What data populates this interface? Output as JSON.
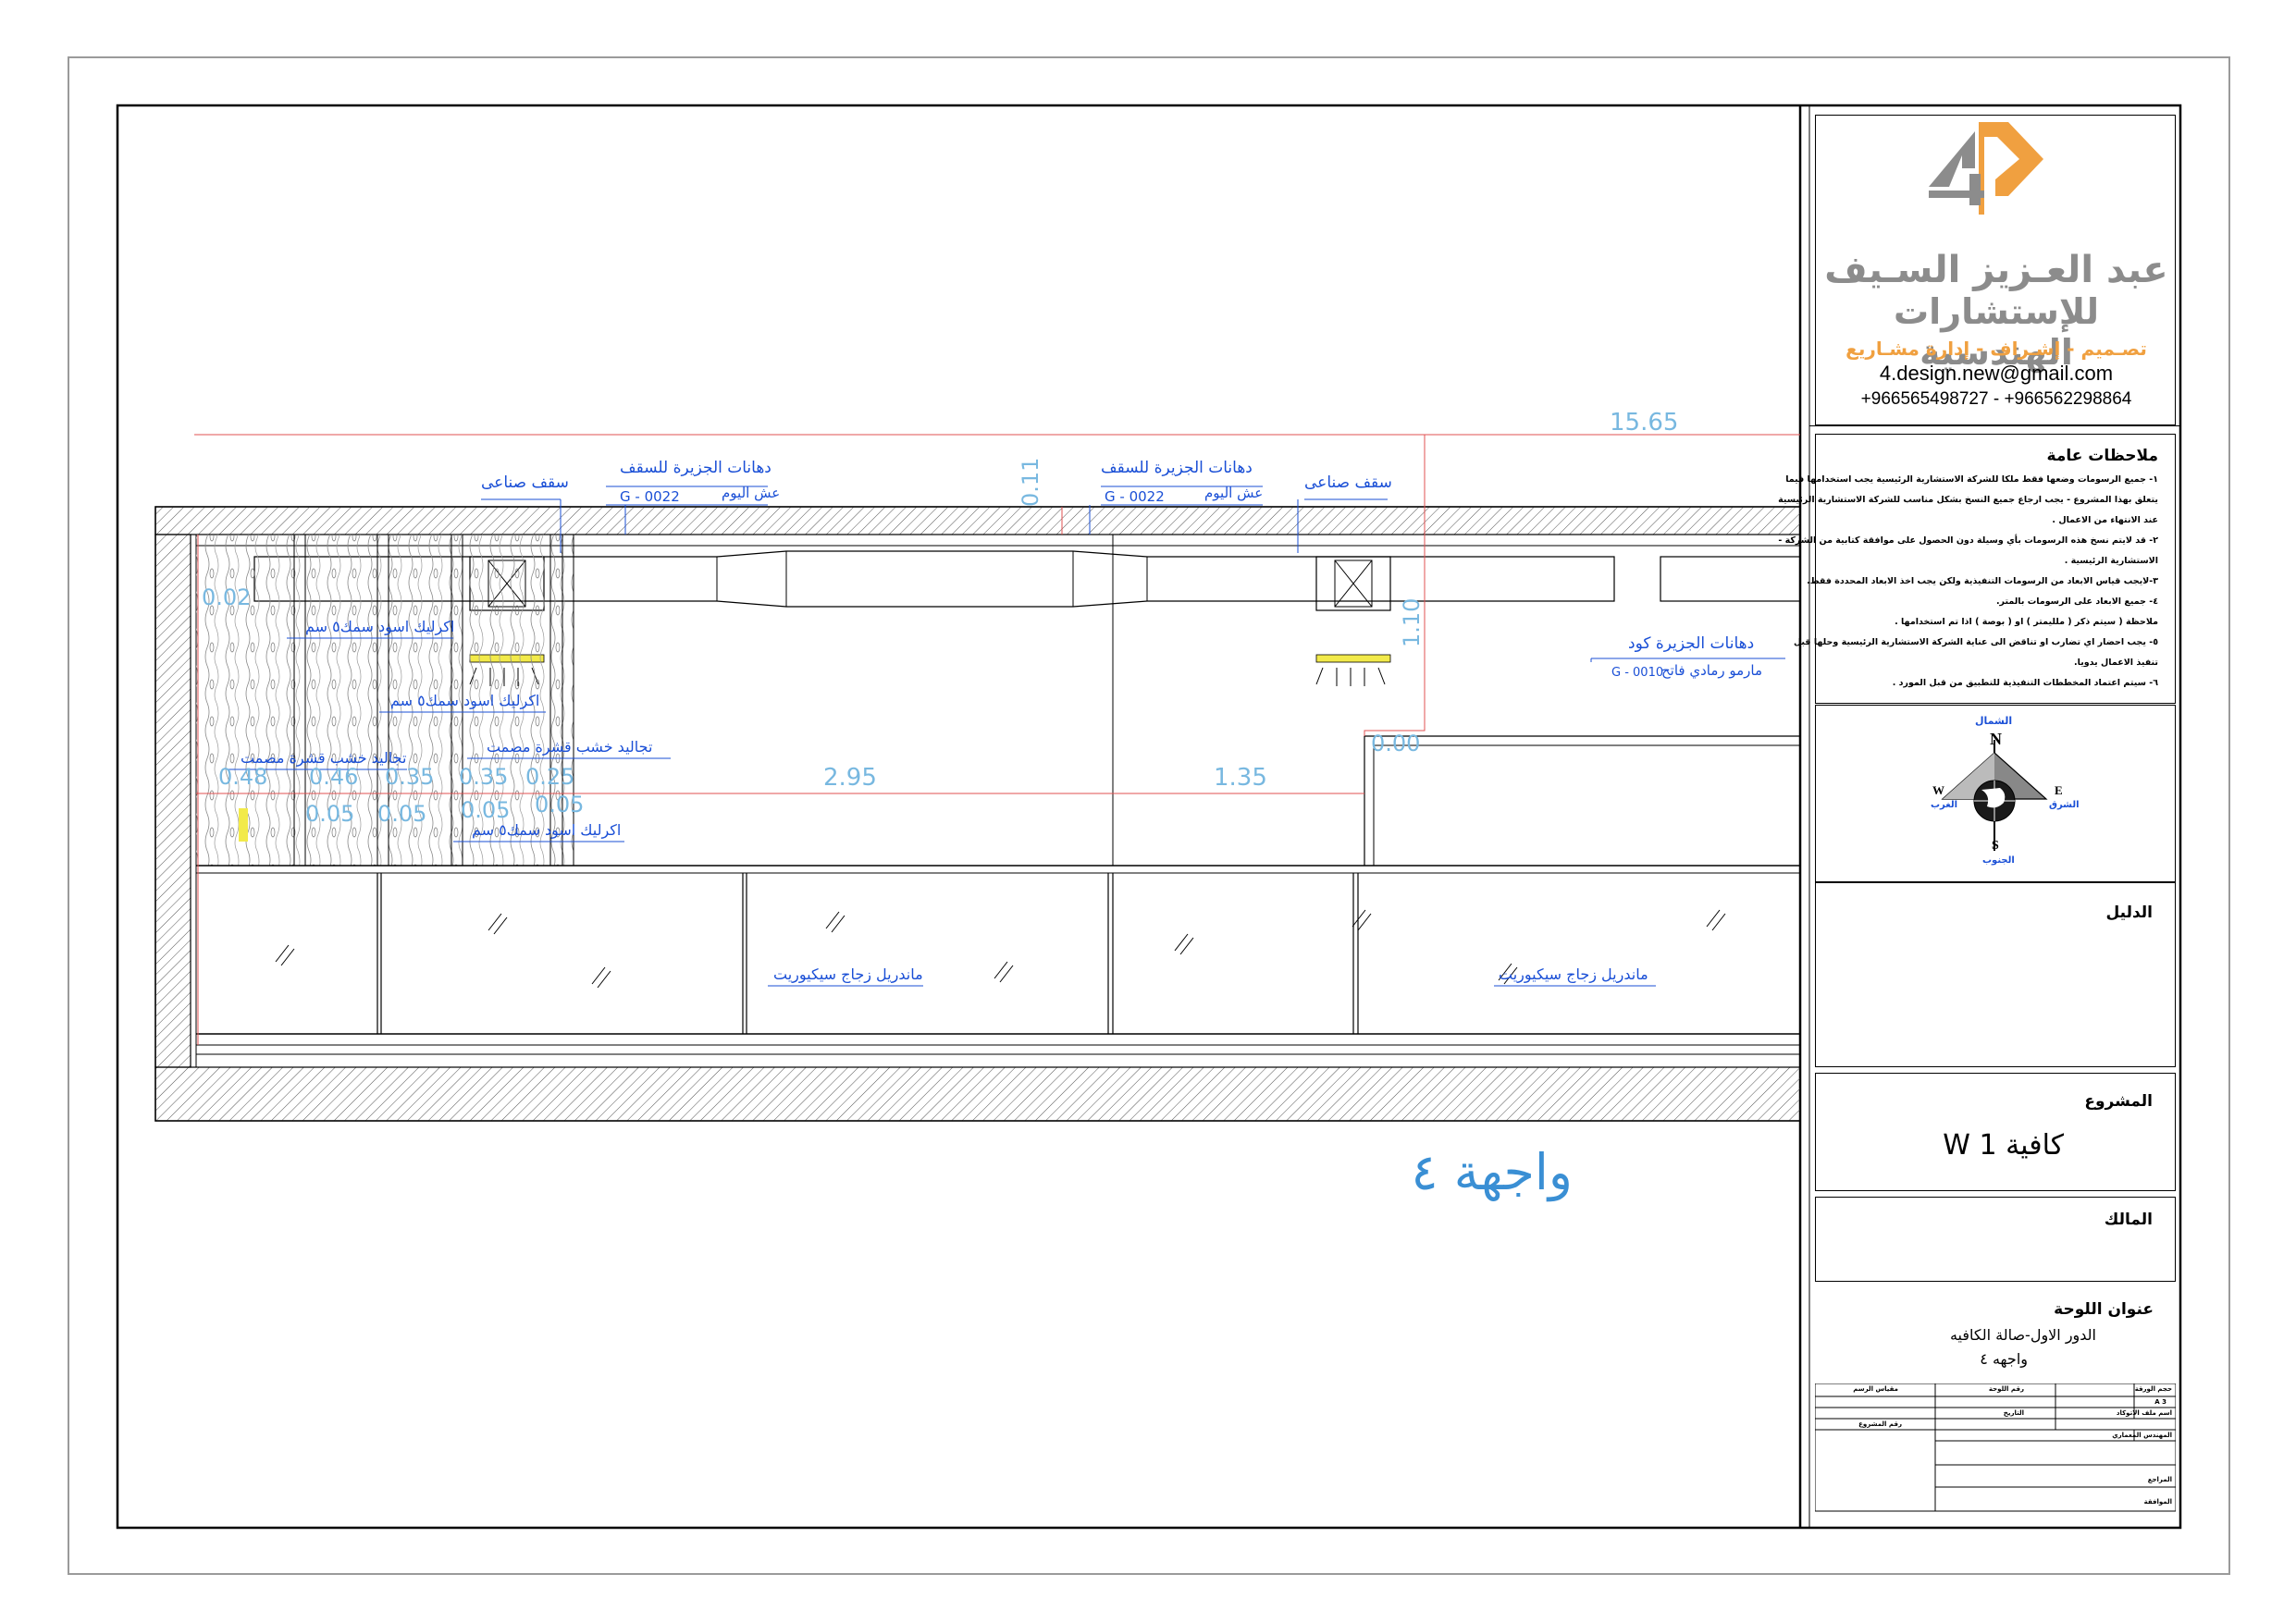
{
  "drawing": {
    "title": "واجهة ٤",
    "dimensions": {
      "overall": "15.65",
      "d_011": "0.11",
      "d_110": "1.10",
      "d_000": "0.00",
      "d_002": "0.02",
      "d_295": "2.95",
      "d_135": "1.35",
      "d_048": "0.48",
      "d_046": "0.46",
      "d_035a": "0.35",
      "d_035b": "0.35",
      "d_025": "0.25",
      "d_005a": "0.05",
      "d_005b": "0.05",
      "d_005c": "0.05",
      "d_005d": "0.05"
    },
    "annotations": {
      "ceiling_left": "سقف صناعى",
      "ceiling_right": "سقف صناعى",
      "paint1_title": "دهانات الجزيرة للسقف",
      "paint1_code": "G - 0022",
      "paint1_name": "عش اليوم",
      "paint2_title": "دهانات الجزيرة للسقف",
      "paint2_code": "G - 0022",
      "paint2_name": "عش اليوم",
      "paint3_title": "دهانات الجزيرة كود",
      "paint3_code": "G - 0010",
      "paint3_name": "مارمو رمادي فاتح",
      "acrylic1": "اكرليك اسود سمك٥ سم",
      "acrylic2": "اكرليك اسود سمك٥ سم",
      "acrylic3": "اكرليك اسود سمك٥ سم",
      "wood1": "تجاليد خشب قشرة مصمت",
      "wood2": "تجاليد خشب قشرة مصمت",
      "glass1": "ماندريل زجاج سيكيوريت",
      "glass2": "ماندريل زجاج سيكيوريت"
    }
  },
  "title_block": {
    "brand_line1": "عبد العـزيز السـيف",
    "brand_line2": "للإستشارات الهندسية",
    "brand_tagline": "تصـميم - إشـراف - إدارة مشـاريع",
    "email": "4.design.new@gmail.com",
    "phones": "+966565498727 - +966562298864",
    "notes_title": "ملاحظات عامة",
    "notes": [
      "١- جميع الرسومات وضعها فقط ملكا للشركة الاستشارية الرئيسية يجب استخدامها فيما",
      "يتعلق بهذا المشروع - يجب ارجاع جميع النسخ بشكل مناسب للشركة الاستشارية الرئيسية",
      "عند الانتهاء من الاعمال .",
      "٢- قد لايتم نسخ هذه الرسومات بأي وسيلة دون الحصول على موافقة كتابية من الشركة -",
      "الاستشارية الرئيسية .",
      "٣-لايجب قياس الابعاد من الرسومات التنفيذية ولكن يجب اخذ الابعاد المحددة فقط.",
      "٤- جميع الابعاد على الرسومات بالمتر.",
      "ملاحظة ( سيتم ذكر ( ملليمتر ) او ( بوصة ) اذا تم استخدامها .",
      "٥- يجب احضار اي تضارب او تناقض الى عناية الشركة الاستشارية الرئيسية وحلها قبل",
      "تنفيذ الاعمال يدويا.",
      "٦- سيتم اعتماد المخططات التنفيذية للتطبيق من قبل المورد ."
    ],
    "compass": {
      "north_letter": "N",
      "south_letter": "S",
      "east_letter": "E",
      "west_letter": "W",
      "north_ar": "الشمال",
      "south_ar": "الجنوب",
      "east_ar": "الشرق",
      "west_ar": "الغرب"
    },
    "legend_label": "الدليل",
    "project_label": "المشروع",
    "project_value": "كافية W 1",
    "owner_label": "المالك",
    "sheet_title_label": "عنوان اللوحة",
    "sheet_title_line1": "الدور الاول-صالة الكافيه",
    "sheet_title_line2": "واجهه ٤",
    "table": {
      "paper_size_label": "حجم الورقة",
      "paper_size_value": "A 3",
      "sheet_no_label": "رقم اللوحة",
      "scale_label": "مقياس الرسم",
      "consultant_label": "اسم ملف الاتوكاد",
      "date_label": "التاريخ",
      "project_no_label": "رقم المشروع",
      "architect_label": "المهندس المعماري",
      "reviewer_label": "المراجع",
      "approval_label": "الموافقة"
    }
  }
}
